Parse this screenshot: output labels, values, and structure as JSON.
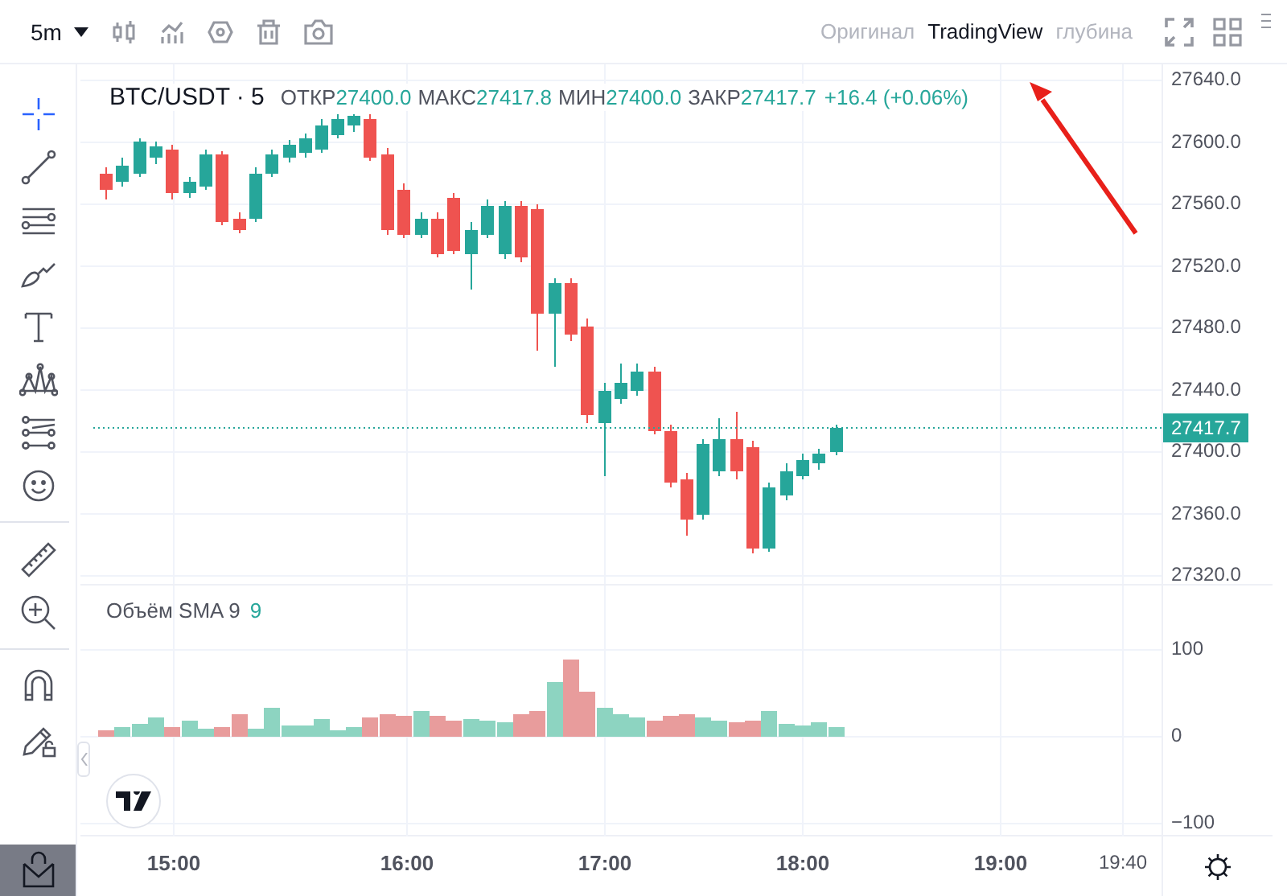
{
  "toolbar": {
    "interval": "5m",
    "view_tabs": [
      {
        "label": "Оригинал",
        "selected": false
      },
      {
        "label": "TradingView",
        "selected": true
      },
      {
        "label": "глубина",
        "selected": false
      }
    ]
  },
  "drawing_tools": [
    {
      "kind": "crosshair",
      "selected": true
    },
    {
      "kind": "trendline",
      "selected": false
    },
    {
      "kind": "lines",
      "selected": false
    },
    {
      "kind": "brush",
      "selected": false
    },
    {
      "kind": "text",
      "selected": false
    },
    {
      "kind": "pattern",
      "selected": false
    },
    {
      "kind": "fib",
      "selected": false
    },
    {
      "kind": "emoji",
      "selected": false
    },
    {
      "kind": "ruler",
      "selected": false
    },
    {
      "kind": "zoom",
      "selected": false
    },
    {
      "kind": "magnet",
      "selected": false
    },
    {
      "kind": "pencil_lock",
      "selected": false
    },
    {
      "kind": "lock",
      "selected": false
    }
  ],
  "legend": {
    "symbol": "BTC/USDT · 5",
    "open_label": "ОТКР",
    "open": "27400.0",
    "high_label": "МАКС",
    "high": "27417.8",
    "low_label": "МИН",
    "low": "27400.0",
    "close_label": "ЗАКР",
    "close": "27417.7",
    "change": "+16.4 (+0.06%)"
  },
  "price_axis": {
    "ticks": [
      "27640.0",
      "27600.0",
      "27560.0",
      "27520.0",
      "27480.0",
      "27440.0",
      "27400.0",
      "27360.0",
      "27320.0"
    ],
    "last_price": "27417.7"
  },
  "volume": {
    "title": "Объём SMA 9",
    "value": "9",
    "axis_ticks": [
      "100",
      "0",
      "−100"
    ]
  },
  "time_axis": {
    "ticks": [
      "15:00",
      "16:00",
      "17:00",
      "18:00",
      "19:00",
      "19:40"
    ]
  }
}
